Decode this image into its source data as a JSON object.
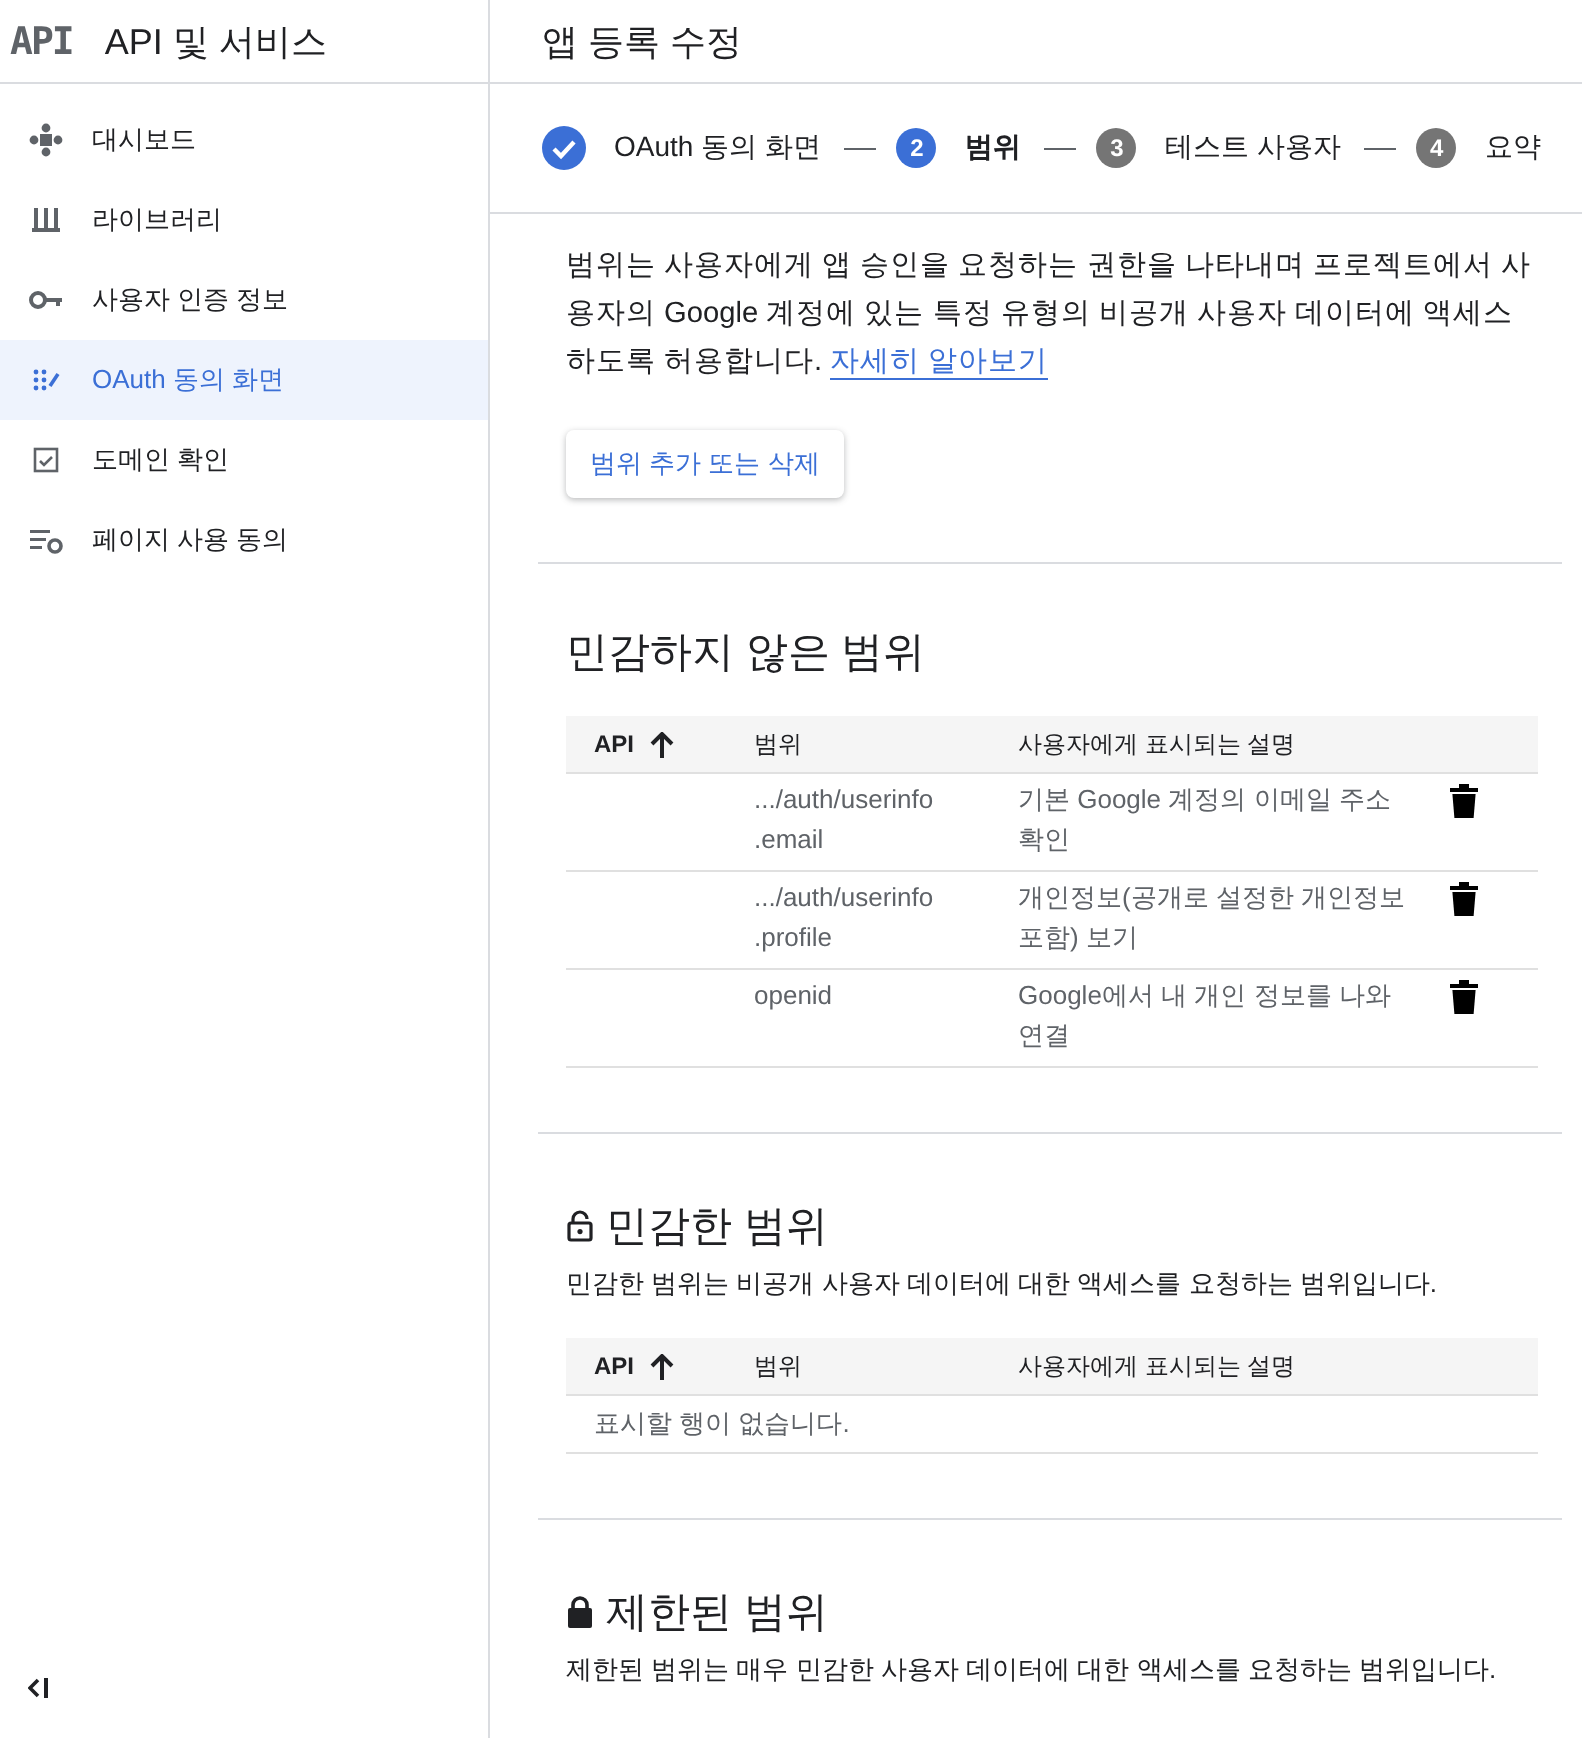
{
  "sidebar": {
    "logo_text": "API",
    "title": "API 및 서비스",
    "items": [
      {
        "label": "대시보드",
        "selected": false
      },
      {
        "label": "라이브러리",
        "selected": false
      },
      {
        "label": "사용자 인증 정보",
        "selected": false
      },
      {
        "label": "OAuth 동의 화면",
        "selected": true
      },
      {
        "label": "도메인 확인",
        "selected": false
      },
      {
        "label": "페이지 사용 동의",
        "selected": false
      }
    ]
  },
  "page_title": "앱 등록 수정",
  "steps": [
    {
      "kind": "completed",
      "label": "OAuth 동의 화면",
      "selected": false
    },
    {
      "kind": "numbered",
      "number": "2",
      "label": "범위",
      "selected": true
    },
    {
      "kind": "numbered",
      "number": "3",
      "label": "테스트 사용자",
      "selected": false
    },
    {
      "kind": "numbered",
      "number": "4",
      "label": "요약",
      "selected": false
    }
  ],
  "intro": {
    "text": "범위는 사용자에게 앱 승인을 요청하는 권한을 나타내며 프로젝트에서 사용자의 Google 계정에 있는 특정 유형의 비공개 사용자 데이터에 액세스하도록 허용합니다.",
    "link": "자세히 알아보기"
  },
  "add_button": "범위 추가 또는 삭제",
  "sections": [
    {
      "kind": "plain",
      "title": "민감하지 않은 범위",
      "table": {
        "columns": [
          {
            "label": "API",
            "sorted": true
          },
          {
            "label": "범위"
          },
          {
            "label": "사용자에게 표시되는 설명"
          }
        ],
        "rows": [
          {
            "scope": ".../auth/userinfo.email",
            "description": "기본 Google 계정의 이메일 주소 확인"
          },
          {
            "scope": ".../auth/userinfo.profile",
            "description": "개인정보(공개로 설정한 개인정보 포함) 보기"
          },
          {
            "scope": "openid",
            "description": "Google에서 내 개인 정보를 나와 연결"
          }
        ]
      }
    },
    {
      "kind": "unlocked",
      "title": "민감한 범위",
      "description": "민감한 범위는 비공개 사용자 데이터에 대한 액세스를 요청하는 범위입니다.",
      "table": {
        "columns": [
          {
            "label": "API",
            "sorted": true
          },
          {
            "label": "범위"
          },
          {
            "label": "사용자에게 표시되는 설명"
          }
        ],
        "empty_text": "표시할 행이 없습니다."
      }
    },
    {
      "kind": "locked",
      "title": "제한된 범위",
      "description": "제한된 범위는 매우 민감한 사용자 데이터에 대한 액세스를 요청하는 범위입니다."
    }
  ]
}
